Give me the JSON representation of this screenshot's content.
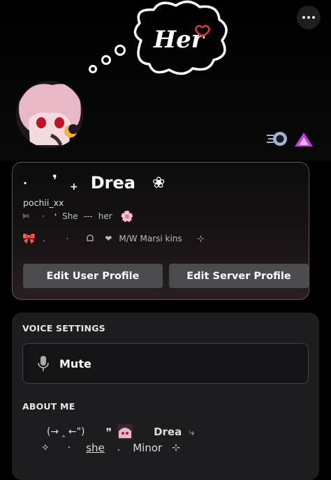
{
  "banner": {
    "cloud_text": "Her"
  },
  "actions": {
    "more": "more-options"
  },
  "profile": {
    "display_name": "Drea",
    "name_decorations": [
      "·",
      "❜",
      "+"
    ],
    "name_flower": "❀",
    "username": "pochii_xx",
    "pronoun_line": {
      "scissors": "✄",
      "dot": "·",
      "apostrophe": "❛",
      "she": "She",
      "dashes": "---",
      "her": "her",
      "flower": "🌸"
    },
    "status_line": {
      "bow": "🎀",
      "dot1": ".",
      "dot2": "·",
      "heart": "❤",
      "text": "M/W Marsi kins",
      "sparkle": "⊹"
    }
  },
  "buttons": {
    "edit_user": "Edit User Profile",
    "edit_server": "Edit Server Profile"
  },
  "voice": {
    "title": "VOICE SETTINGS",
    "mute_label": "Mute"
  },
  "about": {
    "title": "ABOUT ME",
    "line1": {
      "kaomoji": "(→ ‸ ←\")",
      "quote": "❞",
      "name": "Drea",
      "arrow": "⤷"
    },
    "line2": {
      "sparkle1": "✧",
      "dot1": "·",
      "she": "she",
      "dot2": ".",
      "minor": "Minor",
      "sparkle2": "⊹"
    }
  },
  "colors": {
    "accent_pink": "#e23a7a",
    "badge_purple": "#c13ce8",
    "button_gray": "#4a4a4f"
  }
}
